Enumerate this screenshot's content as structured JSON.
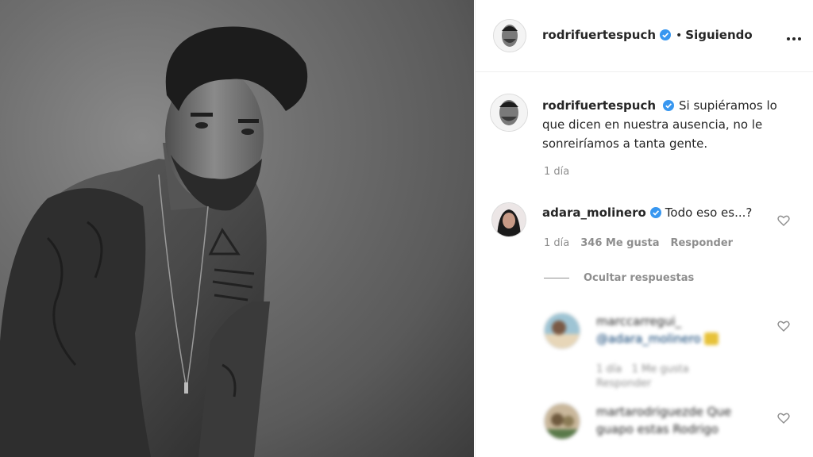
{
  "post": {
    "author": "rodrifuertespuch",
    "follow_status": "Siguiendo",
    "separator": "•"
  },
  "caption": {
    "author": "rodrifuertespuch",
    "text": "Si supiéramos lo que dicen en nuestra ausencia, no le sonreiríamos a tanta gente.",
    "time": "1 día"
  },
  "comment": {
    "author": "adara_molinero",
    "text": "Todo eso es...?",
    "time": "1 día",
    "likes": "346 Me gusta",
    "reply_label": "Responder"
  },
  "replies": {
    "toggle_label": "Ocultar respuestas",
    "items": [
      {
        "author": "marccarregui_",
        "mention": "@adara_molinero",
        "time": "1 día",
        "likes": "1 Me gusta",
        "reply_label": "Responder"
      },
      {
        "author": "martarodriguezde",
        "text": "Que guapo estas Rodrigo"
      }
    ]
  },
  "colors": {
    "verified_badge": "#3897f0",
    "meta_text": "#8e8e8e",
    "divider": "#efefef"
  },
  "icons": [
    "verified-icon",
    "more-options-icon",
    "heart-icon"
  ]
}
